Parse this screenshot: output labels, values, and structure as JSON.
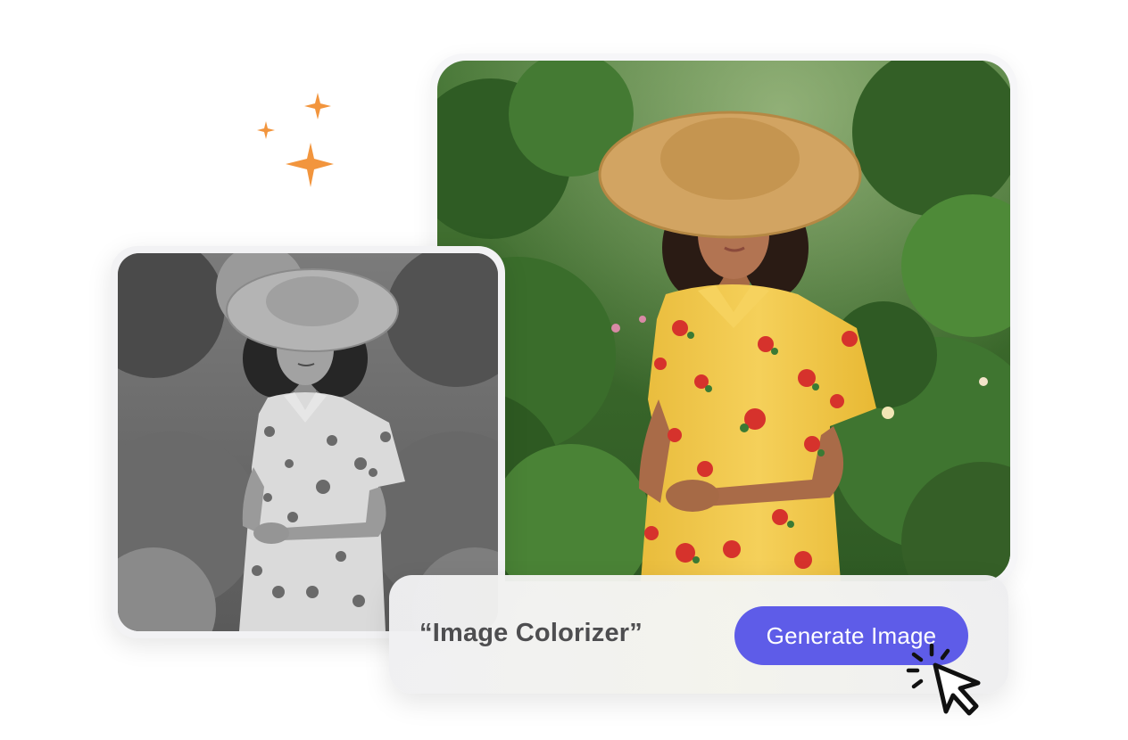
{
  "prompt": {
    "text": "“Image Colorizer”"
  },
  "actions": {
    "generate_label": "Generate Image"
  },
  "icons": {
    "sparkles": "sparkles-icon",
    "cursor": "click-cursor-icon"
  },
  "colors": {
    "accent": "#5e5ce8",
    "sparkle": "#f2953d",
    "dress": "#f2c84b",
    "hat": "#d4a866",
    "foliage": "#3f6b2e"
  }
}
